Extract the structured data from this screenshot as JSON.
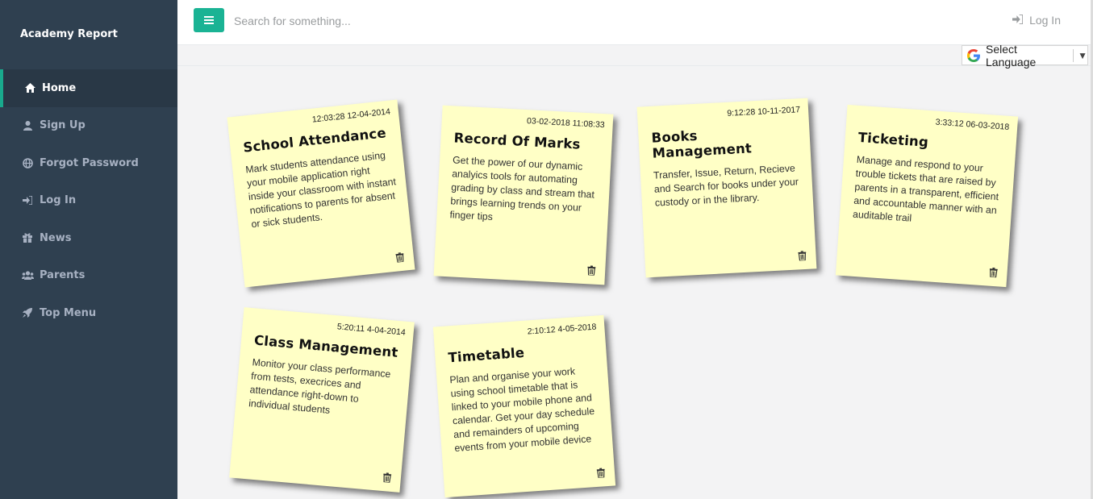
{
  "app": {
    "brand": "Academy Report"
  },
  "sidebar": {
    "items": [
      {
        "label": "Home",
        "icon": "home-icon",
        "active": true
      },
      {
        "label": "Sign Up",
        "icon": "user-icon",
        "active": false
      },
      {
        "label": "Forgot Password",
        "icon": "globe-icon",
        "active": false
      },
      {
        "label": "Log In",
        "icon": "sign-in-icon",
        "active": false
      },
      {
        "label": "News",
        "icon": "gift-icon",
        "active": false
      },
      {
        "label": "Parents",
        "icon": "users-icon",
        "active": false
      },
      {
        "label": "Top Menu",
        "icon": "rocket-icon",
        "active": false
      }
    ]
  },
  "topbar": {
    "search_placeholder": "Search for something...",
    "login_label": "Log In"
  },
  "language": {
    "label": "Select Language"
  },
  "notes": [
    {
      "timestamp": "12:03:28 12-04-2014",
      "title": "School Attendance",
      "body": "Mark students attendance using your mobile application right inside your classroom with instant notifications to parents for absent or sick students."
    },
    {
      "timestamp": "03-02-2018 11:08:33",
      "title": "Record Of Marks",
      "body": "Get the power of our dynamic analyics tools for automating grading by class and stream that brings learning trends on your finger tips"
    },
    {
      "timestamp": "9:12:28 10-11-2017",
      "title": "Books Management",
      "body": "Transfer, Issue, Return, Recieve and Search for books under your custody or in the library."
    },
    {
      "timestamp": "3:33:12 06-03-2018",
      "title": "Ticketing",
      "body": "Manage and respond to your trouble tickets that are raised by parents in a transparent, efficient and accountable manner with an auditable trail"
    },
    {
      "timestamp": "5:20:11 4-04-2014",
      "title": "Class Management",
      "body": "Monitor your class performance from tests, execrices and attendance right-down to individual students"
    },
    {
      "timestamp": "2:10:12 4-05-2018",
      "title": "Timetable",
      "body": "Plan and organise your work using school timetable that is linked to your mobile phone and calendar. Get your day schedule and remainders of upcoming events from your mobile device"
    }
  ],
  "colors": {
    "sidebar": "#2f4050",
    "accent": "#1ab394",
    "note": "#ffffc6"
  }
}
